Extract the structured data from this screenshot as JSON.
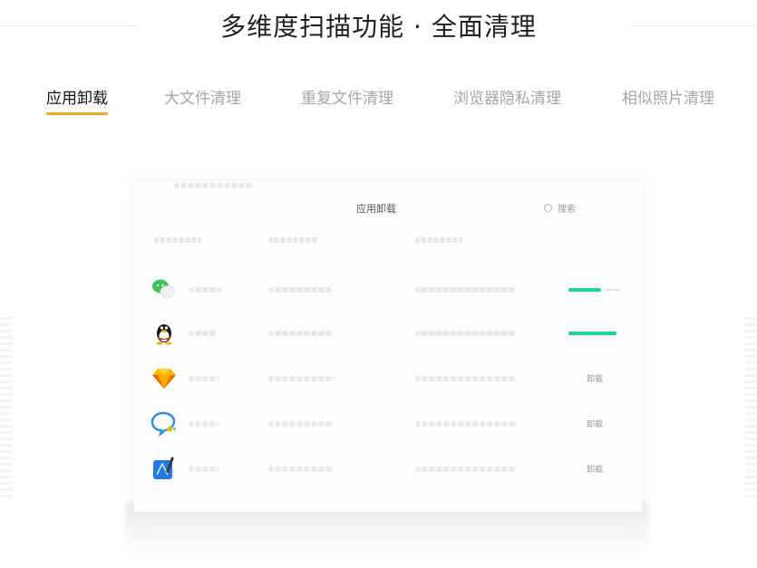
{
  "page_title": "多维度扫描功能 · 全面清理",
  "tabs": [
    {
      "label": "应用卸载",
      "active": true
    },
    {
      "label": "大文件清理",
      "active": false
    },
    {
      "label": "重复文件清理",
      "active": false
    },
    {
      "label": "浏览器隐私清理",
      "active": false
    },
    {
      "label": "相似照片清理",
      "active": false
    }
  ],
  "colors": {
    "tab_underline": "#f5a623",
    "progress": "#1fd1a0",
    "title_text": "#1f1f1f",
    "inactive_tab": "#a6a6a6"
  },
  "window": {
    "title": "应用卸载",
    "search_placeholder": "搜索",
    "apps": [
      {
        "icon": "wechat-icon",
        "progress": 0.6,
        "action": ""
      },
      {
        "icon": "qq-icon",
        "progress": 1.0,
        "action": ""
      },
      {
        "icon": "sketch-icon",
        "progress": null,
        "action": "卸载"
      },
      {
        "icon": "wework-icon",
        "progress": null,
        "action": "卸载"
      },
      {
        "icon": "xcode-icon",
        "progress": null,
        "action": "卸载"
      }
    ]
  }
}
